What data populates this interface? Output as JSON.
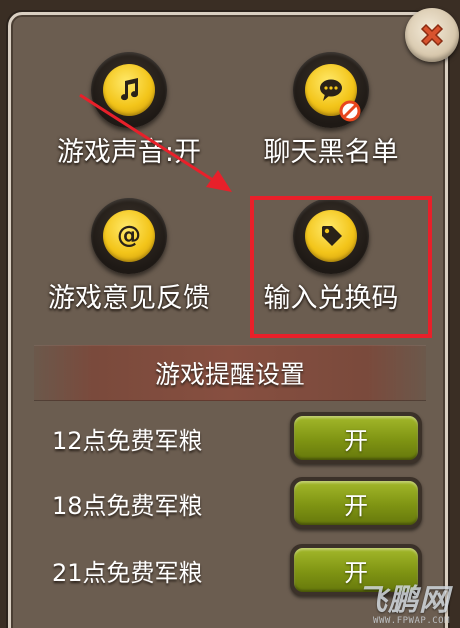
{
  "menu": {
    "items": [
      {
        "label": "游戏声音:开",
        "icon": "music-note-icon"
      },
      {
        "label": "聊天黑名单",
        "icon": "chat-blocked-icon"
      },
      {
        "label": "游戏意见反馈",
        "icon": "at-sign-icon"
      },
      {
        "label": "输入兑换码",
        "icon": "tag-icon"
      }
    ]
  },
  "reminder": {
    "title": "游戏提醒设置",
    "rows": [
      {
        "label": "12点免费军粮",
        "state": "开"
      },
      {
        "label": "18点免费军粮",
        "state": "开"
      },
      {
        "label": "21点免费军粮",
        "state": "开"
      }
    ]
  },
  "watermark": {
    "logo": "飞鹏网",
    "url": "WWW.FPWAP.COM"
  },
  "colors": {
    "panel": "#6b5d50",
    "accent_gold": "#f3c51a",
    "highlight_red": "#e8202a",
    "toggle_green": "#7f9413"
  }
}
